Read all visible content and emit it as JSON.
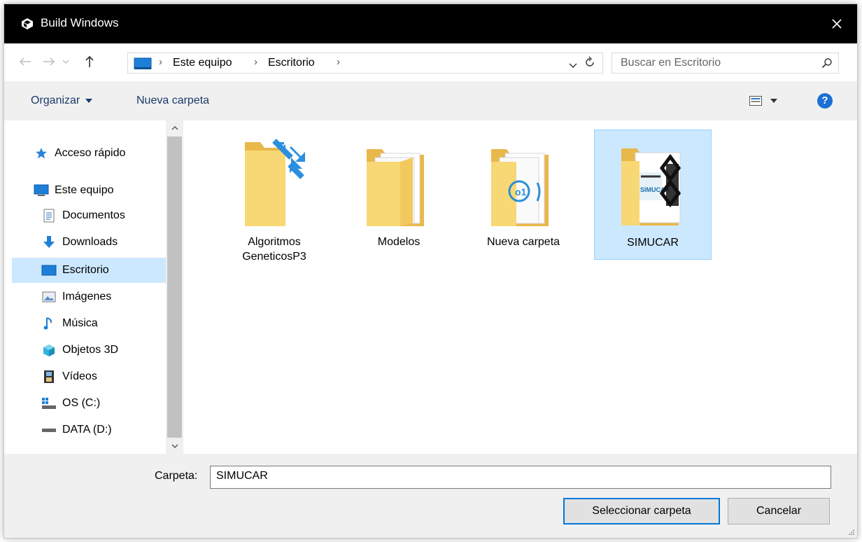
{
  "window": {
    "title": "Build Windows",
    "close_label": "✕"
  },
  "address_bar": {
    "breadcrumb": [
      "Este equipo",
      "Escritorio"
    ],
    "search_placeholder": "Buscar en Escritorio"
  },
  "toolbar": {
    "organize_label": "Organizar",
    "new_folder_label": "Nueva carpeta",
    "help_label": "?"
  },
  "nav_pane": {
    "items": [
      {
        "label": "Acceso rápido",
        "icon": "star-icon"
      },
      {
        "label": "Este equipo",
        "icon": "computer-icon"
      },
      {
        "label": "Documentos",
        "icon": "documents-icon"
      },
      {
        "label": "Downloads",
        "icon": "download-icon"
      },
      {
        "label": "Escritorio",
        "icon": "desktop-icon",
        "selected": true
      },
      {
        "label": "Imágenes",
        "icon": "pictures-icon"
      },
      {
        "label": "Música",
        "icon": "music-icon"
      },
      {
        "label": "Objetos 3D",
        "icon": "3d-objects-icon"
      },
      {
        "label": "Vídeos",
        "icon": "videos-icon"
      },
      {
        "label": "OS (C:)",
        "icon": "drive-c-icon"
      },
      {
        "label": "DATA (D:)",
        "icon": "drive-d-icon"
      }
    ]
  },
  "files": [
    {
      "name_line1": "Algoritmos",
      "name_line2": "GeneticosP3",
      "icon": "folder-shortcut-icon"
    },
    {
      "name_line1": "Modelos",
      "name_line2": "",
      "icon": "folder-icon"
    },
    {
      "name_line1": "Nueva carpeta",
      "name_line2": "",
      "icon": "folder-icon"
    },
    {
      "name_line1": "SIMUCAR",
      "name_line2": "",
      "icon": "folder-icon",
      "selected": true
    }
  ],
  "folder_thumbnail_text": "SIMUCAR",
  "bottom": {
    "folder_label": "Carpeta:",
    "folder_value": "SIMUCAR",
    "select_button": "Seleccionar carpeta",
    "cancel_button": "Cancelar"
  },
  "colors": {
    "titlebar": "#000000",
    "selection": "#cce8ff",
    "accent": "#0078d7",
    "folder": "#f8d775"
  }
}
